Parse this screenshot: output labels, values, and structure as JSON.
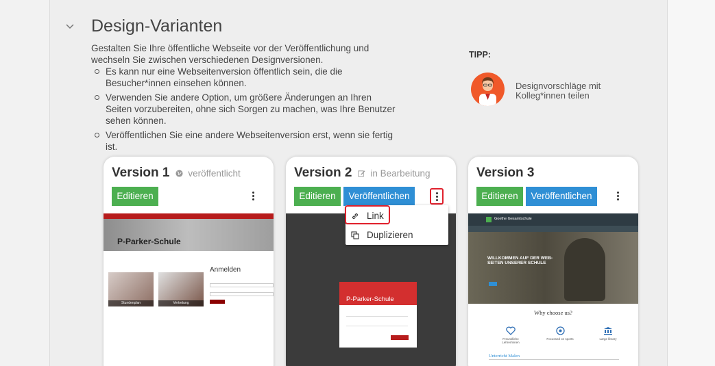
{
  "section": {
    "title": "Design-Varianten",
    "intro": "Gestalten Sie Ihre öffentliche Webseite vor der Veröffentlichung und wechseln Sie zwischen verschiedenen Designversionen.",
    "bullets": [
      "Es kann nur eine Webseitenversion öffentlich sein, die die Besucher*innen einsehen können.",
      "Verwenden Sie andere Option, um größere Änderungen an Ihren Seiten vorzubereiten, ohne sich Sorgen zu machen, was Ihre Benutzer sehen können.",
      "Veröffentlichen Sie eine andere Webseitenversion erst, wenn sie fertig ist."
    ]
  },
  "tip": {
    "label": "TIPP:",
    "text": "Designvorschläge mit Kolleg*innen teilen"
  },
  "cards": [
    {
      "title": "Version 1",
      "status": "veröffentlicht",
      "edit_label": "Editieren",
      "preview": {
        "brand": "P-Parker-Schule",
        "login_title": "Anmelden",
        "tile1": "Stundenplan",
        "tile2": "Vertretung"
      }
    },
    {
      "title": "Version 2",
      "status": "in Bearbeitung",
      "edit_label": "Editieren",
      "publish_label": "Veröffentlichen",
      "preview": {
        "brand": "P-Parker-Schule"
      }
    },
    {
      "title": "Version 3",
      "edit_label": "Editieren",
      "publish_label": "Veröffentlichen",
      "preview": {
        "school": "Goethe Gesamtschule",
        "hero_text": "WILLKOMMEN AUF DER WEB-SEITEN UNSERER SCHULE",
        "why": "Why choose us?",
        "features": [
          "Freundliche Lehrer/innen",
          "Focussed on sports",
          "Large library"
        ],
        "sub": "Unterricht Malen"
      }
    }
  ],
  "menu": {
    "items": [
      {
        "label": "Link",
        "icon": "link-icon"
      },
      {
        "label": "Duplizieren",
        "icon": "duplicate-icon"
      }
    ]
  },
  "colors": {
    "green": "#4caf50",
    "blue": "#2f8fd5",
    "highlight": "#e0202c",
    "avatar": "#f0592a"
  }
}
